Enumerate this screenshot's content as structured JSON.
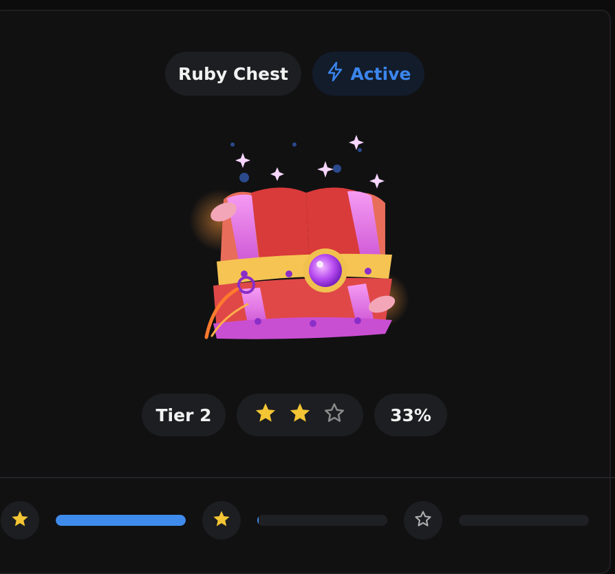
{
  "chest": {
    "name": "Ruby Chest",
    "status": "Active",
    "tier": "Tier 2",
    "stars_filled": 2,
    "stars_total": 3,
    "progress_text": "33%"
  },
  "track": {
    "nodes": [
      {
        "icon": "star-filled-icon",
        "segment_fill": 1.0
      },
      {
        "icon": "star-filled-icon",
        "segment_fill": 0.01
      },
      {
        "icon": "star-outline-icon",
        "segment_fill": 0.0
      }
    ]
  },
  "colors": {
    "accent": "#3b86ee",
    "star": "#f4c534",
    "star_empty": "#8a8a8a",
    "pill_bg": "#1d1e21"
  }
}
